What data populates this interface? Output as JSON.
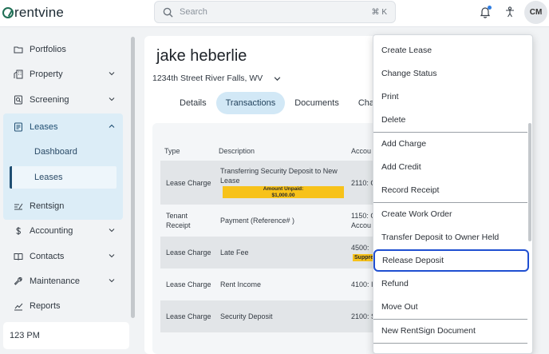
{
  "header": {
    "logo_text": "rentvine",
    "search_placeholder": "Search",
    "search_shortcut": "⌘ K",
    "avatar_initials": "CM",
    "accent_color": "#2f7de1"
  },
  "sidebar": {
    "items": [
      {
        "label": "Portfolios",
        "icon": "folder-icon"
      },
      {
        "label": "Property",
        "icon": "building-icon"
      },
      {
        "label": "Screening",
        "icon": "screening-icon"
      },
      {
        "label": "Leases",
        "icon": "document-icon"
      },
      {
        "label": "Rentsign",
        "icon": "signature-icon"
      },
      {
        "label": "Accounting",
        "icon": "dollar-icon"
      },
      {
        "label": "Contacts",
        "icon": "book-icon"
      },
      {
        "label": "Maintenance",
        "icon": "wrench-icon"
      },
      {
        "label": "Reports",
        "icon": "chart-icon"
      }
    ],
    "leases_subitems": [
      "Dashboard",
      "Leases"
    ],
    "footer_time": "123 PM"
  },
  "lease": {
    "tenant_name": "jake heberlie",
    "address": "1234th Street River Falls, WV",
    "tabs": [
      "Details",
      "Transactions",
      "Documents",
      "Chat"
    ],
    "active_tab": "Transactions"
  },
  "table": {
    "headers": [
      "Type",
      "Description",
      "Accou"
    ],
    "rows": [
      {
        "type": "Lease Charge",
        "description": "Transferring Security Deposit to New Lease",
        "account": "2110: C",
        "badge_line1": "Amount Unpaid:",
        "badge_line2": "$1,000.00"
      },
      {
        "type": "Tenant Receipt",
        "description": "Payment (Reference# )",
        "account": "1150: C",
        "account_line2": "Accou"
      },
      {
        "type": "Lease Charge",
        "description": "Late Fee",
        "account": "4500:",
        "badge": "Suppre"
      },
      {
        "type": "Lease Charge",
        "description": "Rent Income",
        "account": "4100: I"
      },
      {
        "type": "Lease Charge",
        "description": "Security Deposit",
        "account": "2100: S"
      }
    ],
    "unpaid_color": "#f7c21a"
  },
  "menu": {
    "items": [
      "Create Lease",
      "Change Status",
      "Print",
      "Delete",
      "Add Charge",
      "Add Credit",
      "Record Receipt",
      "Create Work Order",
      "Transfer Deposit to Owner Held",
      "Release Deposit",
      "Refund",
      "Move Out",
      "New RentSign Document"
    ],
    "highlighted": "Release Deposit",
    "highlight_color": "#1f4fd1"
  }
}
